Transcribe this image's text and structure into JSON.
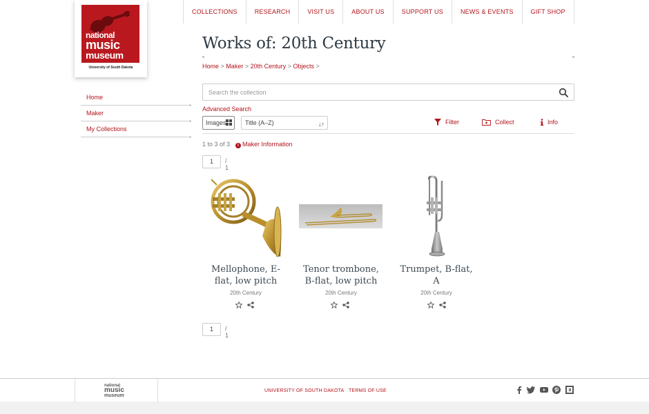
{
  "logo": {
    "line1": "national",
    "line2": "music",
    "line3": "museum",
    "sub": "University of South Dakota",
    "brand_color": "#b9191e"
  },
  "topnav": [
    "COLLECTIONS",
    "RESEARCH",
    "VISIT US",
    "ABOUT US",
    "SUPPORT US",
    "NEWS & EVENTS",
    "GIFT SHOP"
  ],
  "sidenav": [
    "Home",
    "Maker",
    "My Collections"
  ],
  "page": {
    "title": "Works of: 20th Century",
    "breadcrumb": [
      "Home",
      "Maker",
      "20th Century",
      "Objects"
    ],
    "breadcrumb_sep": ">"
  },
  "search": {
    "placeholder": "Search the collection",
    "value": "",
    "icon": "search-icon"
  },
  "advanced_search": "Advanced Search",
  "toolbar": {
    "images_label": "Images",
    "sort_value": "Title (A–Z)",
    "filter_label": "Filter",
    "collect_label": "Collect",
    "info_label": "Info"
  },
  "results": {
    "count_text": "1 to 3 of 3",
    "maker_info": "Maker Information"
  },
  "pager": {
    "page": "1",
    "total": "/ 1"
  },
  "objects": [
    {
      "name_line1": "Mellophone, E-",
      "name_line2": "flat, low pitch",
      "era": "20th Century"
    },
    {
      "name_line1": "Tenor trombone,",
      "name_line2": "B-flat, low pitch",
      "era": "20th Century"
    },
    {
      "name_line1": "Trumpet, B-flat,",
      "name_line2": "A",
      "era": "20th Century"
    }
  ],
  "footer": {
    "logo_l1": "national",
    "logo_l2": "music",
    "logo_l3": "museum",
    "links": [
      "UNIVERSITY OF SOUTH DAKOTA",
      "TERMS OF USE"
    ],
    "social_icons": [
      "facebook-icon",
      "twitter-icon",
      "youtube-icon",
      "pinterest-icon",
      "other-social-icon"
    ]
  },
  "colors": {
    "accent": "#b2141c",
    "title": "#2e3a44"
  }
}
